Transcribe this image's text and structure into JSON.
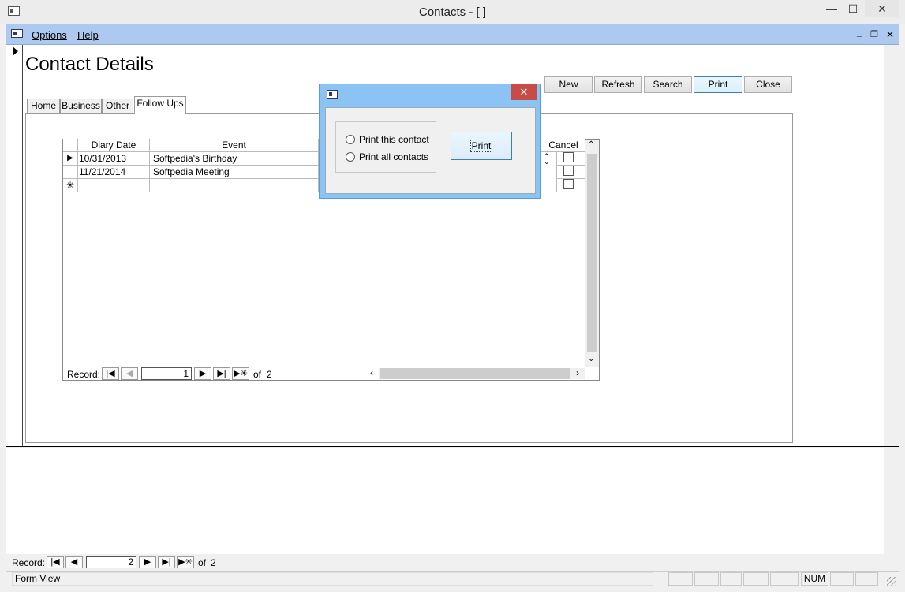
{
  "window": {
    "title": "Contacts - [ ]",
    "minimize": "—",
    "maximize": "☐",
    "close": "✕"
  },
  "menubar": {
    "options": "Options",
    "help": "Help",
    "mdi_min": "_",
    "mdi_restore": "❐",
    "mdi_close": "✕"
  },
  "form": {
    "title": "Contact Details",
    "buttons": {
      "new": "New",
      "refresh": "Refresh",
      "search": "Search",
      "print": "Print",
      "close": "Close"
    },
    "tabs": [
      "Home",
      "Business",
      "Other",
      "Follow Ups"
    ]
  },
  "grid": {
    "columns": [
      "Diary Date",
      "Event",
      "Cancel"
    ],
    "rows": [
      {
        "date": "10/31/2013",
        "event": "Softpedia's Birthday"
      },
      {
        "date": "11/21/2014",
        "event": "Softpedia Meeting"
      }
    ],
    "new_row_marker": "✳",
    "current_row_marker": "▶",
    "nav": {
      "label": "Record:",
      "current": "1",
      "of_text": "of",
      "total": "2"
    }
  },
  "dialog": {
    "close": "✕",
    "options": [
      "Print this contact",
      "Print all contacts"
    ],
    "print_button": "Print"
  },
  "main_nav": {
    "label": "Record:",
    "current": "2",
    "of_text": "of",
    "total": "2"
  },
  "statusbar": {
    "view": "Form View",
    "num": "NUM"
  },
  "nav_glyphs": {
    "first": "|◀",
    "prev": "◀",
    "next": "▶",
    "last": "▶|",
    "new": "▶✳"
  },
  "colors": {
    "menubar": "#aec9ef",
    "dialog_frame": "#8bc4f4",
    "close_red": "#c74c45"
  }
}
